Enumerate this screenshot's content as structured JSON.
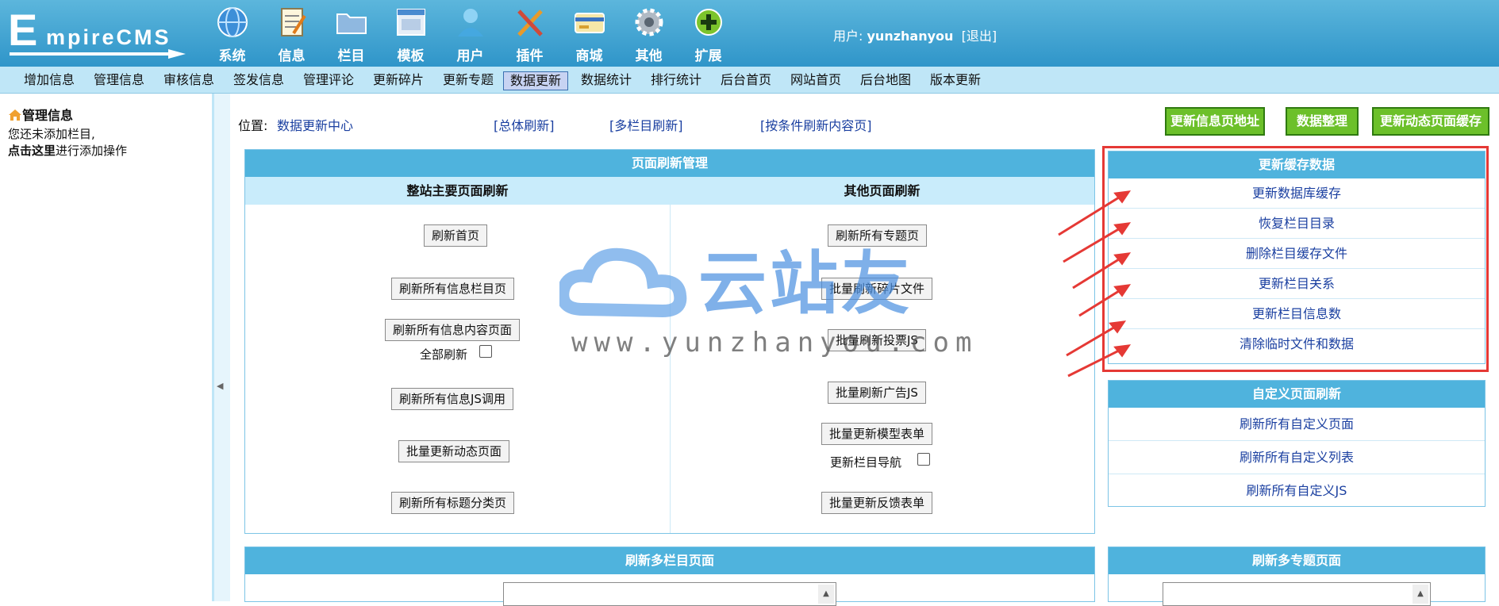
{
  "logo": {
    "letter": "E",
    "text": "mpireCMS"
  },
  "nav": [
    {
      "label": "系统",
      "icon": "globe-icon"
    },
    {
      "label": "信息",
      "icon": "notepad-icon"
    },
    {
      "label": "栏目",
      "icon": "folder-icon"
    },
    {
      "label": "模板",
      "icon": "window-icon"
    },
    {
      "label": "用户",
      "icon": "user-icon"
    },
    {
      "label": "插件",
      "icon": "tools-icon"
    },
    {
      "label": "商城",
      "icon": "card-icon"
    },
    {
      "label": "其他",
      "icon": "gear-icon"
    },
    {
      "label": "扩展",
      "icon": "plus-icon"
    }
  ],
  "user": {
    "prefix": "用户:",
    "name": "yunzhanyou",
    "logout": "[退出]"
  },
  "menu": [
    "增加信息",
    "管理信息",
    "审核信息",
    "签发信息",
    "管理评论",
    "更新碎片",
    "更新专题",
    "数据更新",
    "数据统计",
    "排行统计",
    "后台首页",
    "网站首页",
    "后台地图",
    "版本更新"
  ],
  "menu_active": "数据更新",
  "sidebar": {
    "title": "管理信息",
    "line1": "您还未添加栏目,",
    "link": "点击这里",
    "line2": "进行添加操作"
  },
  "location": {
    "label": "位置:",
    "crumb": "数据更新中心",
    "links": [
      "[总体刷新]",
      "[多栏目刷新]",
      "[按条件刷新内容页]"
    ]
  },
  "top_buttons": [
    "更新信息页地址",
    "数据整理",
    "更新动态页面缓存"
  ],
  "refresh_panel": {
    "title": "页面刷新管理",
    "left_title": "整站主要页面刷新",
    "right_title": "其他页面刷新",
    "left_buttons": [
      "刷新首页",
      "刷新所有信息栏目页",
      "刷新所有信息内容页面",
      "刷新所有信息JS调用",
      "批量更新动态页面",
      "刷新所有标题分类页"
    ],
    "full_refresh_label": "全部刷新",
    "right_buttons": [
      "刷新所有专题页",
      "批量刷新碎片文件",
      "批量刷新投票JS",
      "批量刷新广告JS",
      "批量更新模型表单",
      "批量更新反馈表单"
    ],
    "nav_label": "更新栏目导航"
  },
  "cache_panel": {
    "title": "更新缓存数据",
    "links": [
      "更新数据库缓存",
      "恢复栏目目录",
      "删除栏目缓存文件",
      "更新栏目关系",
      "更新栏目信息数",
      "清除临时文件和数据"
    ]
  },
  "custom_panel": {
    "title": "自定义页面刷新",
    "links": [
      "刷新所有自定义页面",
      "刷新所有自定义列表",
      "刷新所有自定义JS"
    ]
  },
  "multi_col_panel": {
    "title": "刷新多栏目页面"
  },
  "multi_topic_panel": {
    "title": "刷新多专题页面"
  },
  "watermark": {
    "brand": "云站友",
    "url": "www.yunzhanyou.com"
  },
  "colors": {
    "header": "#3fa3d4",
    "menubar": "#bfe6f7",
    "panel_head": "#4fb3dd",
    "green_button": "#6cc02a",
    "highlight": "#e53935",
    "link": "#1a3fa0"
  }
}
